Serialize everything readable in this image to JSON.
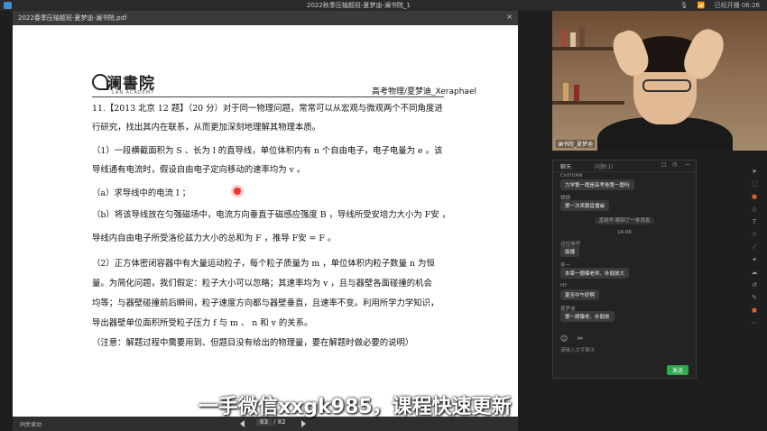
{
  "titlebar": {
    "window_title": "2022秋季压轴题班-夏梦迪-澜书院_1",
    "network": "丨",
    "time": "已经开播 06:26",
    "wifi_icon": "wifi-icon",
    "mic_icon": "mic-icon"
  },
  "pdf": {
    "filename": "2022春季压轴题班-夏梦迪-澜书院.pdf",
    "close": "×",
    "brand_cn": "澜書院",
    "brand_en": "LAN ACADEMY",
    "header_right": "高考物理/夏梦迪_Xeraphael",
    "lines": [
      "11.【2013 北京 12 题】（20 分）对于同一物理问题，常常可以从宏观与微观两个不同角度进",
      "行研究，找出其内在联系，从而更加深刻地理解其物理本质。",
      "（1）一段横截面积为 S 、长为 l 的直导线，单位体积内有 n 个自由电子，电子电量为 e 。该",
      "导线通有电流时，假设自由电子定向移动的速率均为 v 。",
      "（a）求导线中的电流 I ；",
      "（b）将该导线放在匀强磁场中，电流方向垂直于磁感应强度 B ，导线所受安培力大小为 F安 ，",
      "导线内自由电子所受洛伦兹力大小的总和为 F ，推导 F安 = F 。",
      "（2）正方体密闭容器中有大量运动粒子，每个粒子质量为 m ，单位体积内粒子数量 n 为恒",
      "量。为简化问题，我们假定：粒子大小可以忽略；其速率均为 v ，且与器壁各面碰撞的机会",
      "均等；与器壁碰撞前后瞬间，粒子速度方向都与器壁垂直，且速率不变。利用所学力学知识，",
      "导出器壁单位面积所受粒子压力 f 与 m 、 n 和 v 的关系。",
      "（注意：解题过程中需要用到、但题目没有给出的物理量，要在解题时做必要的说明）"
    ],
    "footer_left": "同步滚动",
    "page_current": "63",
    "page_total": "/ 82"
  },
  "overlay": "一手微信xxgk985，课程快速更新",
  "webcam": {
    "label": "澜书院_夏梦迪"
  },
  "chat": {
    "tab_chat": "聊天",
    "tab_qa": "问题(1)",
    "messages": [
      {
        "name": "CiriYUAN",
        "text": "力学第一题是高考卷第一题吗"
      },
      {
        "name": "锅锅",
        "text": "第一次来跟直播😁"
      },
      {
        "system": "孟锐华 刚回了一条消息"
      },
      {
        "system": "14:06"
      },
      {
        "name": "达拉崩吧",
        "text": "能播"
      },
      {
        "name": "李一",
        "text": "本章一题曝老师、补弱放大"
      },
      {
        "name": "HY",
        "text": "夏至中午好啊"
      },
      {
        "name": "夏梦迪",
        "text": "第一题曝老、补弱放"
      }
    ],
    "emoji_icon": "☺",
    "scissors_icon": "✂",
    "input_placeholder": "请输入文字聊天",
    "send": "发送"
  },
  "toolbar_icons": [
    "pointer-icon",
    "select-icon",
    "pen-icon",
    "eraser-icon",
    "text-icon",
    "shape-icon",
    "line-icon",
    "laser-icon",
    "cloud-icon",
    "undo-icon",
    "edit-icon",
    "chat-icon",
    "more-icon"
  ]
}
